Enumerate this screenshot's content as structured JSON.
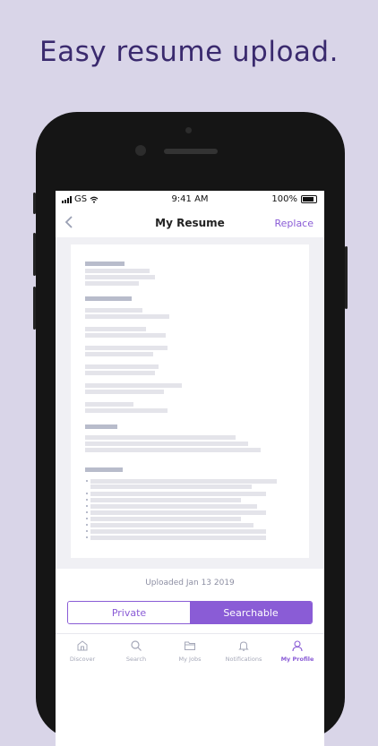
{
  "headline": "Easy resume upload.",
  "status_bar": {
    "carrier": "GS",
    "time": "9:41 AM",
    "battery": "100%"
  },
  "nav": {
    "title": "My Resume",
    "replace_label": "Replace",
    "back_icon": "chevron-left-icon"
  },
  "upload_info": "Uploaded Jan 13 2019",
  "visibility_toggle": {
    "options": [
      "Private",
      "Searchable"
    ],
    "selected": "Searchable"
  },
  "tabs": [
    {
      "label": "Discover",
      "icon": "home-icon",
      "active": false
    },
    {
      "label": "Search",
      "icon": "search-icon",
      "active": false
    },
    {
      "label": "My Jobs",
      "icon": "folder-icon",
      "active": false
    },
    {
      "label": "Notifications",
      "icon": "bell-icon",
      "active": false
    },
    {
      "label": "My Profile",
      "icon": "profile-icon",
      "active": true
    }
  ],
  "colors": {
    "accent": "#8a5cd6",
    "headline": "#3a2a6e",
    "background": "#d9d5e8"
  }
}
